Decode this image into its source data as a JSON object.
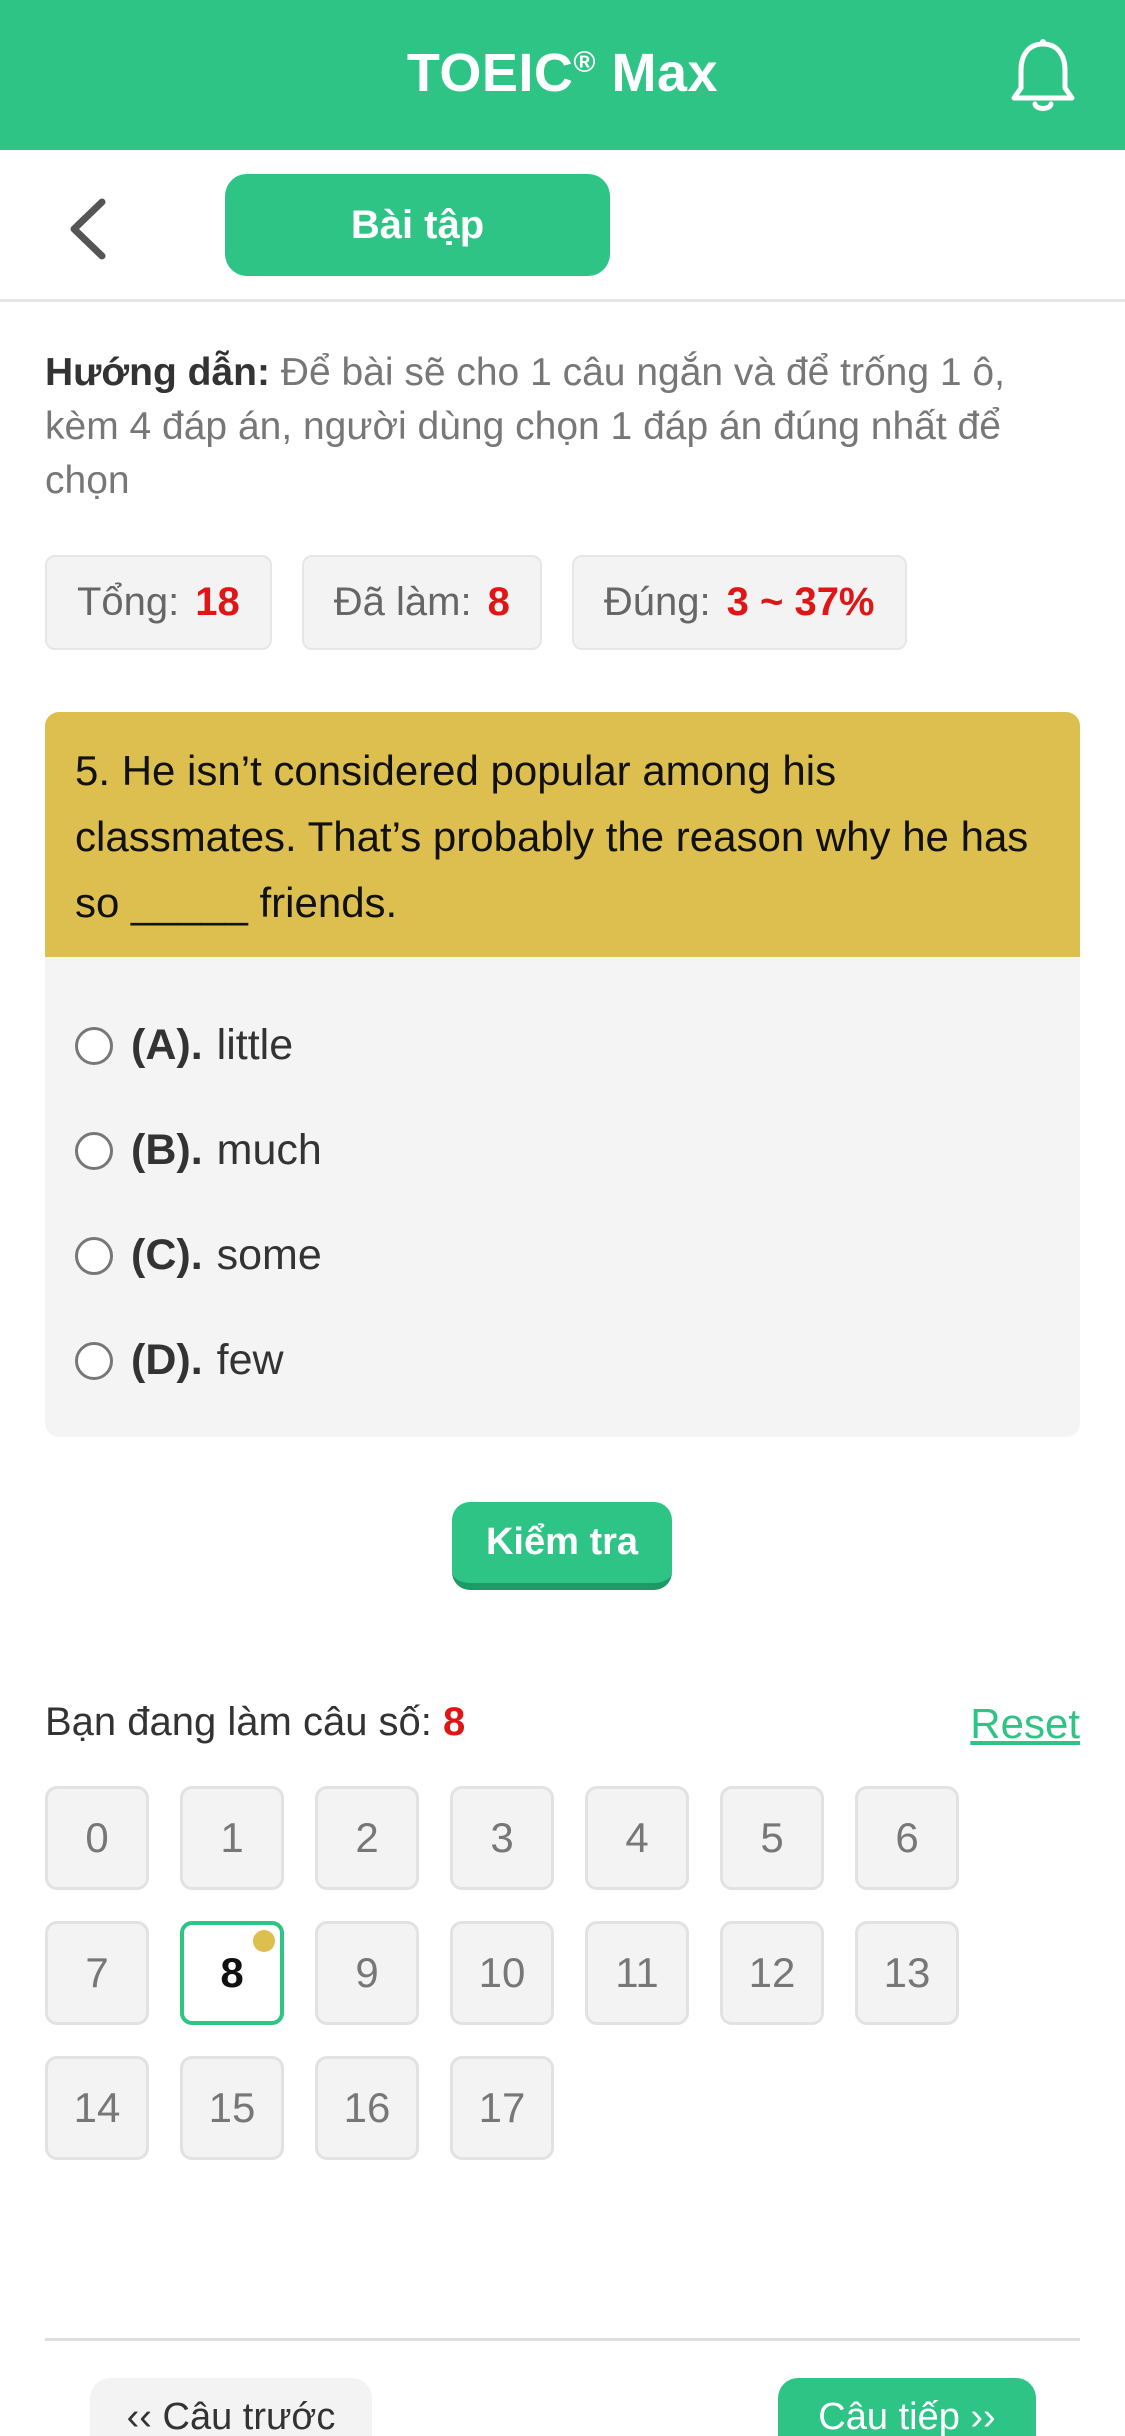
{
  "header": {
    "title": "TOEIC",
    "title_mark": "®",
    "title_suffix": " Max",
    "bell_icon": "bell-icon"
  },
  "toolbar": {
    "back_icon": "chevron-left-icon",
    "tab_label": "Bài tập"
  },
  "instructions": {
    "label": "Hướng dẫn:",
    "text": " Để bài sẽ cho 1 câu ngắn và để trống 1 ô, kèm 4 đáp án, người dùng chọn 1 đáp án đúng nhất để chọn"
  },
  "stats": [
    {
      "label": "Tổng:",
      "value": "18"
    },
    {
      "label": "Đã làm:",
      "value": "8"
    },
    {
      "label": "Đúng:",
      "value": "3 ~ 37%"
    }
  ],
  "question": {
    "text": "5. He isn’t considered popular among his classmates. That’s probably the reason why he has so _____ friends.",
    "options": [
      {
        "key": "(A).",
        "text": "little"
      },
      {
        "key": "(B).",
        "text": "much"
      },
      {
        "key": "(C).",
        "text": "some"
      },
      {
        "key": "(D).",
        "text": "few"
      }
    ]
  },
  "check_button": "Kiểm tra",
  "progress": {
    "label": "Bạn đang làm câu số:",
    "current": "8",
    "reset_label": "Reset"
  },
  "question_numbers": [
    "0",
    "1",
    "2",
    "3",
    "4",
    "5",
    "6",
    "7",
    "8",
    "9",
    "10",
    "11",
    "12",
    "13",
    "14",
    "15",
    "16",
    "17"
  ],
  "active_question": "8",
  "nav": {
    "prev_label": "‹‹ Câu trước",
    "next_label": "Câu tiếp ››"
  },
  "colors": {
    "brand": "#2ec486",
    "question_bg": "#dcbf4e",
    "highlight_number": "#e01515"
  }
}
